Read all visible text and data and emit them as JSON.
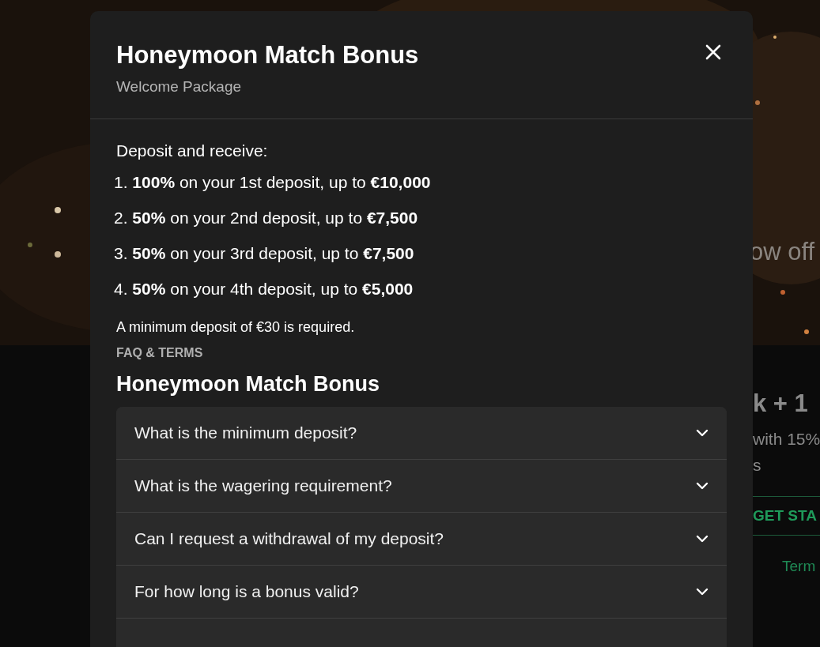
{
  "background": {
    "hero_text": "ow off",
    "card_title": "k + 1",
    "card_lines": [
      "with 15%",
      "s"
    ],
    "cta_button": "GET STA",
    "terms_link": "Term"
  },
  "modal": {
    "title": "Honeymoon Match Bonus",
    "subtitle": "Welcome Package",
    "intro": "Deposit and receive:",
    "tiers": [
      "1. **100%** on your 1st deposit, up to **€10,000**",
      "2. **50%** on your 2nd deposit, up to **€7,500**",
      "3. **50%** on your 3rd deposit, up to **€7,500**",
      "4. **50%** on your 4th deposit, up to **€5,000**"
    ],
    "note": "A minimum deposit of €30 is required.",
    "section_label": "FAQ & TERMS",
    "faq_title": "Honeymoon Match Bonus",
    "faq": [
      {
        "question": "What is the minimum deposit?",
        "expanded": false
      },
      {
        "question": "What is the wagering requirement?",
        "expanded": false
      },
      {
        "question": "Can I request a withdrawal of my deposit?",
        "expanded": false
      },
      {
        "question": "For how long is a bonus valid?",
        "expanded": false
      }
    ]
  }
}
